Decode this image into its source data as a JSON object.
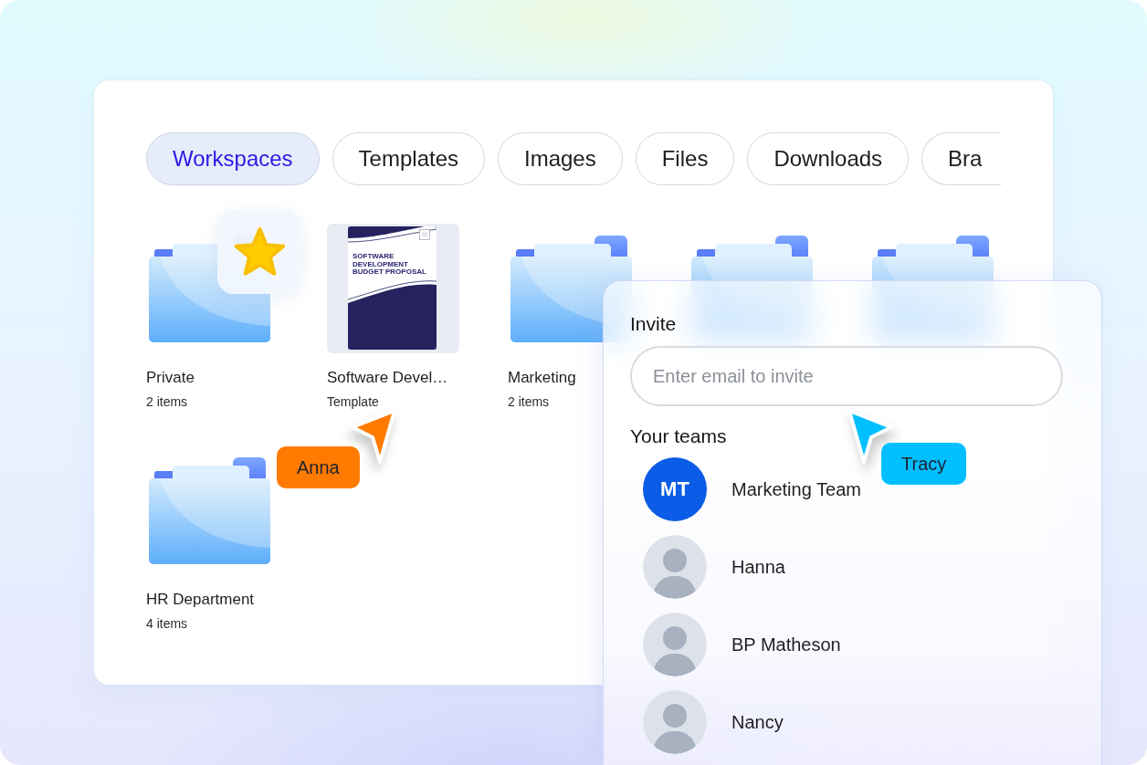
{
  "tabs": [
    {
      "label": "Workspaces",
      "selected": true
    },
    {
      "label": "Templates",
      "selected": false
    },
    {
      "label": "Images",
      "selected": false
    },
    {
      "label": "Files",
      "selected": false
    },
    {
      "label": "Downloads",
      "selected": false
    },
    {
      "label": "Bra",
      "selected": false
    }
  ],
  "items": [
    {
      "kind": "folder",
      "name": "Private",
      "meta": "2 items",
      "starred": true
    },
    {
      "kind": "template",
      "name": "Software Devel…",
      "meta": "Template",
      "cover_title": "SOFTWARE DEVELOPMENT BUDGET PROPOSAL"
    },
    {
      "kind": "folder",
      "name": "Marketing",
      "meta": "2 items",
      "starred": false
    },
    {
      "kind": "folder",
      "starred": false
    },
    {
      "kind": "folder",
      "starred": false
    },
    {
      "kind": "folder",
      "name": "HR Department",
      "meta": "4 items",
      "starred": false
    }
  ],
  "invite": {
    "title": "Invite",
    "placeholder": "Enter email to invite",
    "teams_title": "Your teams",
    "members": [
      {
        "kind": "initials",
        "initials": "MT",
        "name": "Marketing Team"
      },
      {
        "kind": "photo",
        "name": "Hanna"
      },
      {
        "kind": "photo",
        "name": "BP Matheson"
      },
      {
        "kind": "photo",
        "name": "Nancy"
      }
    ]
  },
  "cursors": [
    {
      "name": "Anna",
      "color": "#ff7a00"
    },
    {
      "name": "Tracy",
      "color": "#00bfff"
    }
  ]
}
